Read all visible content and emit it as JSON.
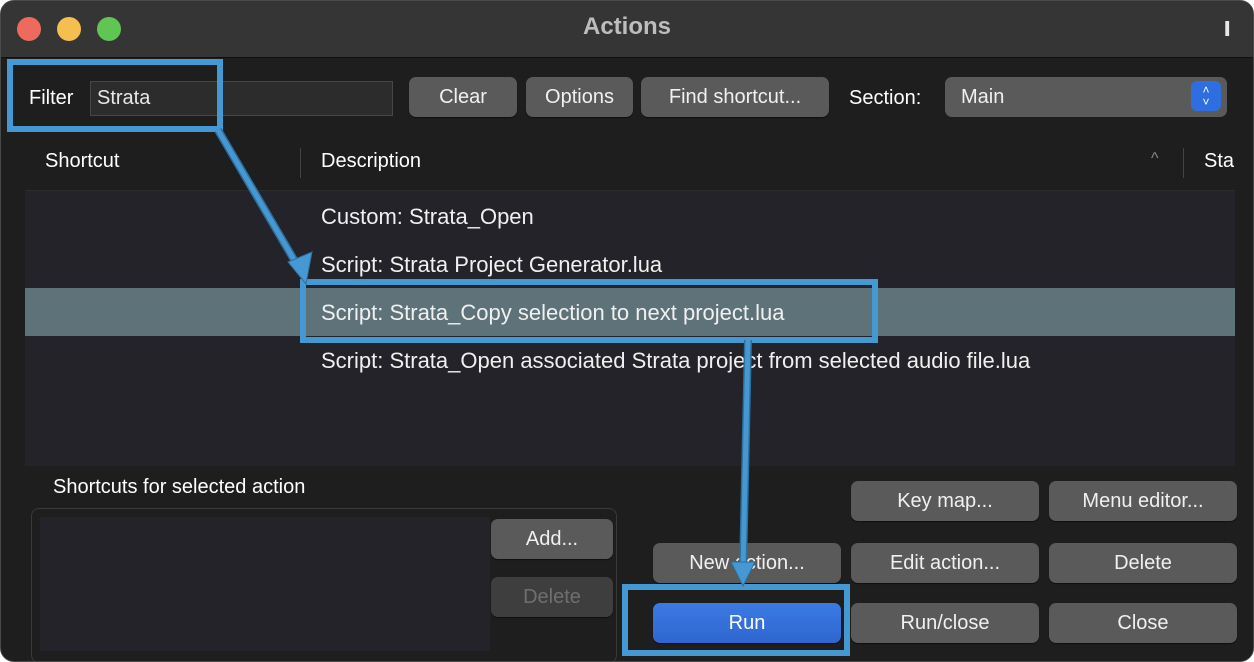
{
  "window": {
    "title": "Actions",
    "traffic_lights": [
      "close",
      "minimize",
      "zoom"
    ],
    "pin_icon": "pin-icon"
  },
  "toolbar": {
    "filter_label": "Filter",
    "filter_value": "Strata",
    "clear_label": "Clear",
    "options_label": "Options",
    "find_shortcut_label": "Find shortcut...",
    "section_label": "Section:",
    "section_value": "Main"
  },
  "table": {
    "columns": [
      "Shortcut",
      "Description",
      "Sta"
    ],
    "sort_indicator": "^",
    "rows": [
      {
        "shortcut": "",
        "description": "Custom: Strata_Open",
        "selected": false
      },
      {
        "shortcut": "",
        "description": "Script: Strata Project Generator.lua",
        "selected": false
      },
      {
        "shortcut": "",
        "description": "Script: Strata_Copy selection to next project.lua",
        "selected": true
      },
      {
        "shortcut": "",
        "description": "Script: Strata_Open associated Strata project from selected audio file.lua",
        "selected": false
      }
    ]
  },
  "shortcuts_panel": {
    "title": "Shortcuts for selected action",
    "add_label": "Add...",
    "delete_label": "Delete"
  },
  "actions": {
    "key_map": "Key map...",
    "menu_editor": "Menu editor...",
    "new_action": "New action...",
    "edit_action": "Edit action...",
    "delete": "Delete",
    "run": "Run",
    "run_close": "Run/close",
    "close": "Close"
  },
  "annotation": {
    "highlight_color": "#4598d2"
  }
}
